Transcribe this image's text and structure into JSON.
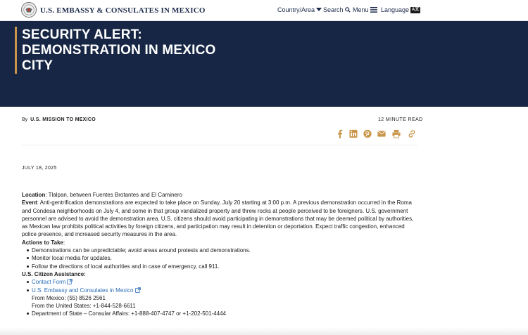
{
  "header": {
    "site_title": "U.S. EMBASSY & CONSULATES IN MEXICO",
    "nav": {
      "country": "Country/Area",
      "search": "Search",
      "menu": "Menu",
      "language": "Language",
      "language_badge": "A文"
    }
  },
  "hero": {
    "title": "SECURITY ALERT: DEMONSTRATION IN MEXICO CITY"
  },
  "article": {
    "by_prefix": "By",
    "author": "U.S. MISSION TO MEXICO",
    "read_time": "12 MINUTE READ",
    "date": "JULY 18, 2025",
    "share_icons": [
      "facebook-icon",
      "linkedin-icon",
      "pinterest-icon",
      "email-icon",
      "print-icon",
      "link-icon"
    ],
    "accent_color": "#c9954a"
  },
  "body": {
    "location_label": "Location",
    "location_text": ": Tlalpan, between Fuentes Brotantes and El Caminero",
    "event_label": "Event",
    "event_text": ":  Anti-gentrification demonstrations are expected to take place on Sunday, July 20 starting at 3:00 p.m.  A previous demonstration occurred in the Roma and Condesa neighborhoods on July 4, and some in that group vandalized property and threw rocks at people perceived to be foreigners. U.S. government personnel are advised to avoid the demonstration area. U.S. citizens should avoid participating in demonstrations that may be deemed political by authorities, as Mexican law prohibits political activities by foreign citizens, and participation may result in detention or deportation. Expect traffic congestion, enhanced police presence, and increased security measures in the area.",
    "actions_heading": "Actions to Take",
    "actions_colon": ":",
    "actions": [
      "Demonstrations can be unpredictable; avoid areas around protests and demonstrations.",
      "Monitor local media for updates.",
      "Follow the directions of local authorities and in case of emergency, call 911."
    ],
    "assistance_heading": "U.S. Citizen Assistance:",
    "contact_form": "Contact Form",
    "embassy_link": "U.S. Embassy and Consulates in Mexico",
    "from_mexico": "From Mexico: (55) 8526 2561",
    "from_us": "From the United States:  +1-844-528-6611",
    "state_dept": "Department of State – Consular Affairs:  +1-888-407-4747 or +1-202-501-4444"
  }
}
